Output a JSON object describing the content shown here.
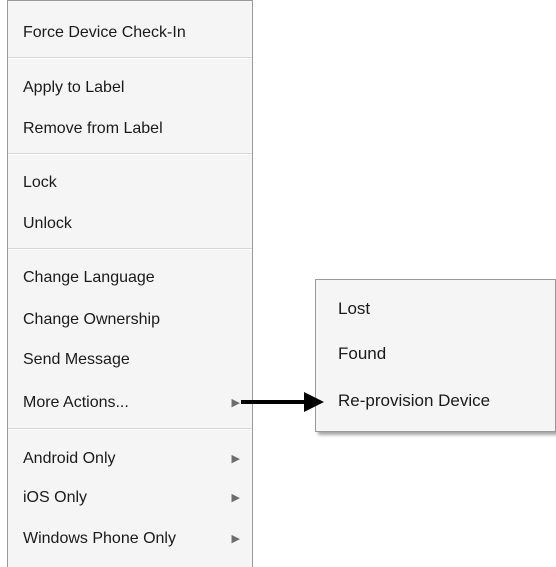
{
  "main_menu": {
    "items": [
      {
        "label": "Force Device Check-In"
      },
      {
        "label": "Apply to Label"
      },
      {
        "label": "Remove from Label"
      },
      {
        "label": "Lock"
      },
      {
        "label": "Unlock"
      },
      {
        "label": "Change Language"
      },
      {
        "label": "Change Ownership"
      },
      {
        "label": "Send Message"
      },
      {
        "label": "More Actions..."
      },
      {
        "label": "Android Only"
      },
      {
        "label": "iOS Only"
      },
      {
        "label": "Windows Phone Only"
      }
    ],
    "submenu_arrow_icon": "triangle-right-icon"
  },
  "more_actions_submenu": {
    "items": [
      {
        "label": "Lost"
      },
      {
        "label": "Found"
      },
      {
        "label": "Re-provision Device"
      }
    ]
  },
  "annotation": {
    "arrow_icon": "right-arrow-icon",
    "color": "#000000"
  }
}
